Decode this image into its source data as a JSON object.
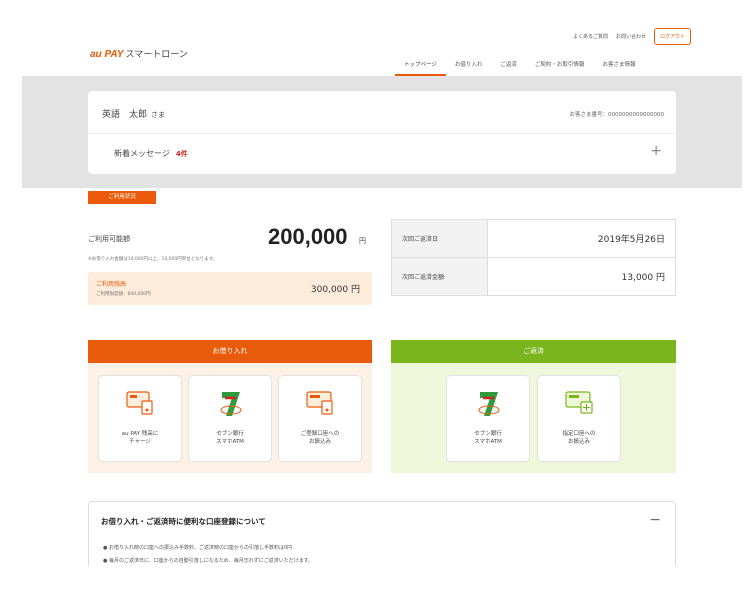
{
  "header": {
    "brand": "au PAY",
    "service": "スマートローン",
    "util_links": [
      "よくあるご質問",
      "お問い合わせ"
    ],
    "logout": "ログアウト",
    "nav": [
      "トップページ",
      "お借り入れ",
      "ご返済",
      "ご契約・お取引情報",
      "お客さま情報"
    ]
  },
  "user": {
    "name": "英語　太郎",
    "honorific": "さま",
    "customer_no": "お客さま番号：0000000000000000",
    "news_label": "新着メッセージ",
    "news_count": "4件"
  },
  "status": {
    "tag": "ご利用状況",
    "available_label": "ご利用可能額",
    "available_value": "200,000",
    "available_unit": "円",
    "note": "※お借り入れ金額は10,000円以上、10,000円単位となります。",
    "balance_label": "ご利用残高",
    "balance_sub": "ご利用限度額：600,000円",
    "balance_value": "300,000 円",
    "next_date_label": "次回ご返済日",
    "next_date_value": "2019年5月26日",
    "next_amount_label": "次回ご返済金額",
    "next_amount_value": "13,000 円"
  },
  "borrow": {
    "title": "お借り入れ",
    "tiles": [
      "au PAY 残高に\nチャージ",
      "セブン銀行\nスマホATM",
      "ご登録口座への\nお振込み"
    ]
  },
  "repay": {
    "title": "ご返済",
    "tiles": [
      "セブン銀行\nスマホATM",
      "指定口座への\nお振込み"
    ]
  },
  "info": {
    "title": "お借り入れ・ご返済時に便利な口座登録について",
    "lines": [
      "● お借り入れ時の口座への振込み手数料、ご返済時の口座からの引落し手数料は0円",
      "● 毎月のご返済日に、口座からの自動引落しになるため、毎月忘れずにご返済いただけます。"
    ]
  },
  "colors": {
    "accent": "#eb5a0a",
    "repay": "#7ab51d",
    "alert": "#d2231e"
  }
}
